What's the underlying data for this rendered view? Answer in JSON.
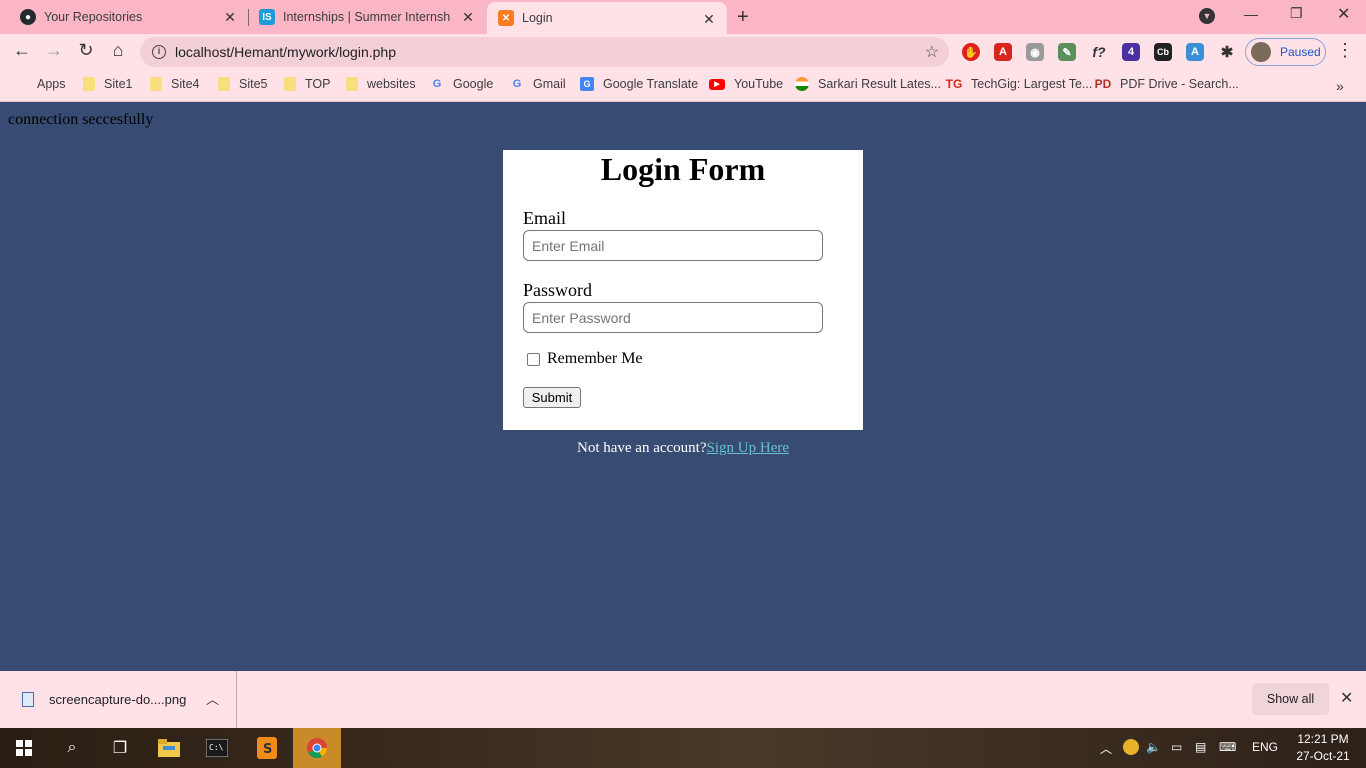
{
  "browser": {
    "tabs": [
      {
        "title": "Your Repositories",
        "icon": "github-icon"
      },
      {
        "title": "Internships | Summer Internship",
        "icon": "internshala-icon"
      },
      {
        "title": "Login",
        "icon": "xampp-icon"
      }
    ],
    "url": "localhost/Hemant/mywork/login.php",
    "profile_label": "Paused",
    "bookmarks": [
      "Apps",
      "Site1",
      "Site4",
      "Site5",
      "TOP",
      "websites",
      "Google",
      "Gmail",
      "Google Translate",
      "YouTube",
      "Sarkari Result Lates...",
      "TechGig: Largest Te...",
      "PDF Drive - Search..."
    ]
  },
  "page": {
    "status_text": "connection seccesfully",
    "form_title": "Login Form",
    "email_label": "Email",
    "email_placeholder": "Enter Email",
    "password_label": "Password",
    "password_placeholder": "Enter Password",
    "remember_label": "Remember Me",
    "submit_label": "Submit",
    "signup_prompt": "Not have an account?",
    "signup_link": "Sign Up Here"
  },
  "downloads": {
    "file_name": "screencapture-do....png",
    "show_all_label": "Show all"
  },
  "taskbar": {
    "language": "ENG",
    "time": "12:21 PM",
    "date": "27-Oct-21"
  },
  "colors": {
    "page_bg": "#374b73",
    "chrome_bg": "#ffe2e8",
    "tabstrip_bg": "#fbb6c6",
    "link": "#66c4c8"
  }
}
